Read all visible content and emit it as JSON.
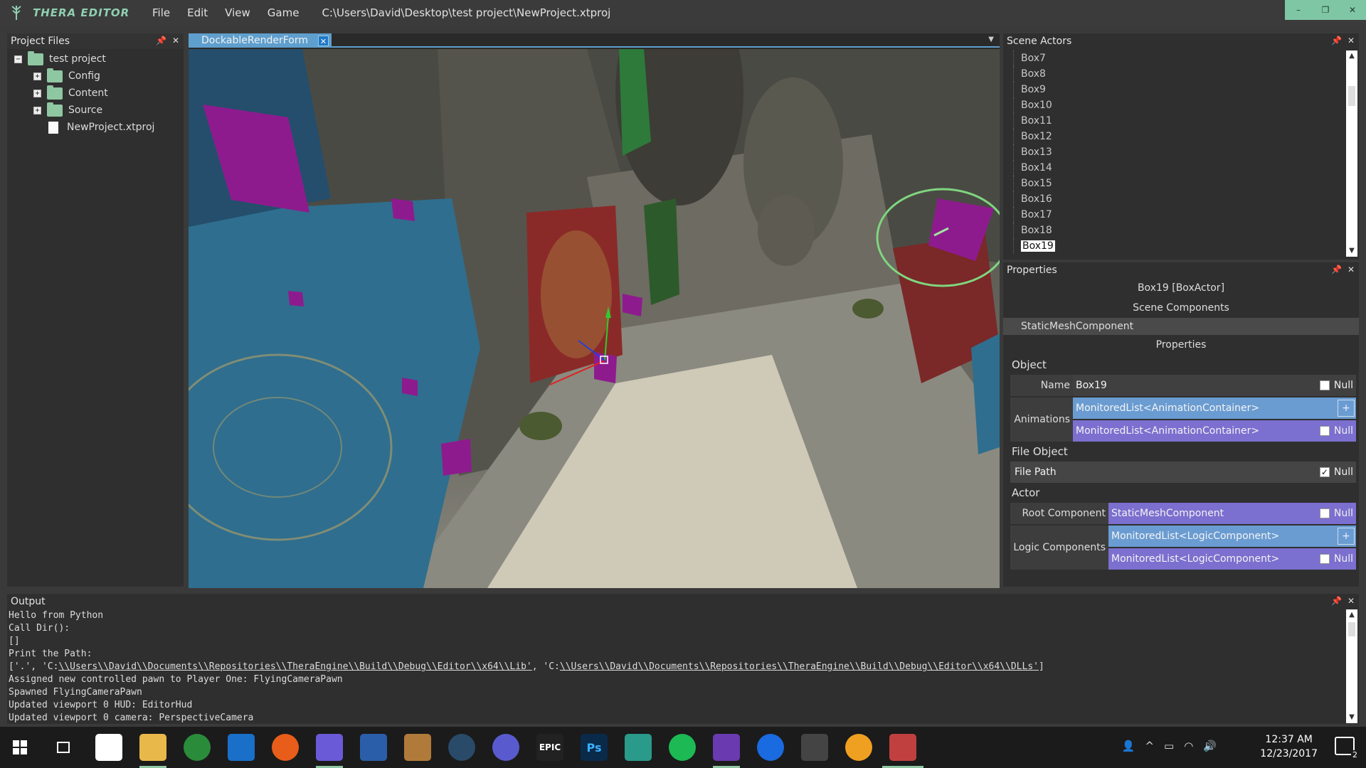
{
  "titlebar": {
    "brand": "THERA EDITOR",
    "menu": [
      "File",
      "Edit",
      "View",
      "Game"
    ],
    "project_path": "C:\\Users\\David\\Desktop\\test project\\NewProject.xtproj",
    "controls": [
      "–",
      "❐",
      "✕"
    ]
  },
  "project_files": {
    "title": "Project Files",
    "tree": [
      {
        "label": "test project",
        "type": "folder",
        "expander": "−",
        "level": 0
      },
      {
        "label": "Config",
        "type": "folder",
        "expander": "+",
        "level": 1
      },
      {
        "label": "Content",
        "type": "folder",
        "expander": "+",
        "level": 1
      },
      {
        "label": "Source",
        "type": "folder",
        "expander": "+",
        "level": 1
      },
      {
        "label": "NewProject.xtproj",
        "type": "file",
        "expander": "",
        "level": 1
      }
    ]
  },
  "document": {
    "tab_label": "DockableRenderForm",
    "tab_close": "✕",
    "dropdown": "▼"
  },
  "scene_actors": {
    "title": "Scene Actors",
    "items": [
      "Box7",
      "Box8",
      "Box9",
      "Box10",
      "Box11",
      "Box12",
      "Box13",
      "Box14",
      "Box15",
      "Box16",
      "Box17",
      "Box18",
      "Box19"
    ],
    "selected": "Box19"
  },
  "properties": {
    "title": "Properties",
    "object_title": "Box19 [BoxActor]",
    "scene_components_label": "Scene Components",
    "component": "StaticMeshComponent",
    "properties_label": "Properties",
    "sections": {
      "object": "Object",
      "file_object": "File Object",
      "actor": "Actor"
    },
    "name_label": "Name",
    "name_value": "Box19",
    "animations_label": "Animations",
    "animations_value_1": "MonitoredList<AnimationContainer>",
    "animations_value_2": "MonitoredList<AnimationContainer>",
    "file_path_label": "File Path",
    "root_component_label": "Root Component",
    "root_component_value": "StaticMeshComponent",
    "logic_components_label": "Logic Components",
    "logic_value_1": "MonitoredList<LogicComponent>",
    "logic_value_2": "MonitoredList<LogicComponent>",
    "null_label": "Null",
    "plus_label": "+",
    "file_path_null_checked": "✓"
  },
  "output": {
    "title": "Output",
    "lines": [
      "Hello from Python",
      "Call Dir():",
      "[]",
      "Print the Path:"
    ],
    "path_line_prefix": "['.', 'C:",
    "path_line_link1": "\\\\Users\\\\David\\\\Documents\\\\Repositories\\\\TheraEngine\\\\Build\\\\Debug\\\\Editor\\\\x64\\\\Lib'",
    "path_line_mid": ", 'C:",
    "path_line_link2": "\\\\Users\\\\David\\\\Documents\\\\Repositories\\\\TheraEngine\\\\Build\\\\Debug\\\\Editor\\\\x64\\\\DLLs'",
    "path_line_suffix": "]",
    "lines_after": [
      "Assigned new controlled pawn to Player One: FlyingCameraPawn",
      "Spawned FlyingCameraPawn",
      "Updated viewport 0 HUD: EditorHud",
      "Updated viewport 0 camera: PerspectiveCamera"
    ]
  },
  "taskbar": {
    "time": "12:37 AM",
    "date": "12/23/2017",
    "notification_count": "2",
    "epic_label": "EPIC",
    "ps_label": "Ps"
  }
}
